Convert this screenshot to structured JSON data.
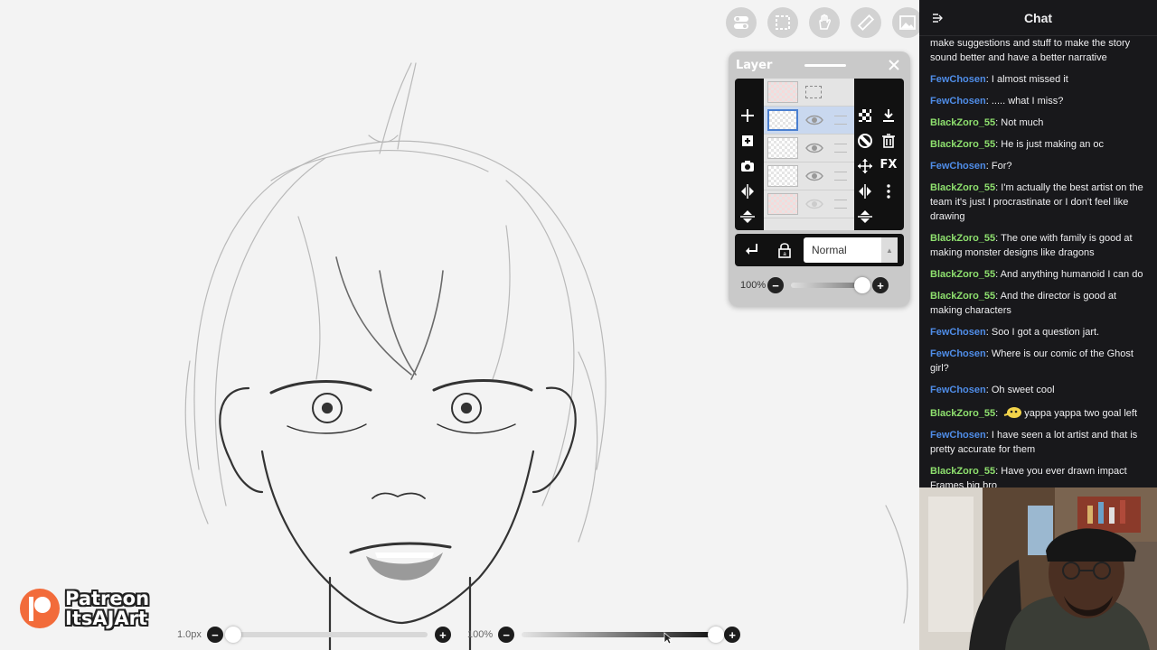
{
  "top_toolbar": {
    "tools": [
      {
        "icon": "toggle-icon"
      },
      {
        "icon": "selection-icon"
      },
      {
        "icon": "hand-icon"
      },
      {
        "icon": "ruler-icon"
      },
      {
        "icon": "image-icon"
      }
    ]
  },
  "layer_panel": {
    "title": "Layer",
    "blend_mode": "Normal",
    "opacity": "100%",
    "fx_label": "FX"
  },
  "bottom_bar": {
    "brush_size": "1.0px",
    "brush_opacity": "100%"
  },
  "watermark": {
    "line1": "Patreon",
    "line2": "ItsAJArt"
  },
  "chat": {
    "title": "Chat",
    "colors": {
      "FewChosen": "#4f8de8",
      "BlackZoro_55": "#8ee06e"
    },
    "messages": [
      {
        "user": "",
        "text": "make suggestions and stuff to make the story sound better and have a better narrative"
      },
      {
        "user": "FewChosen",
        "text": "I almost missed it"
      },
      {
        "user": "FewChosen",
        "text": "..... what I miss?"
      },
      {
        "user": "BlackZoro_55",
        "text": "Not much"
      },
      {
        "user": "BlackZoro_55",
        "text": "He is just making an oc"
      },
      {
        "user": "FewChosen",
        "text": "For?"
      },
      {
        "user": "BlackZoro_55",
        "text": "I'm actually the best artist on the team it's just I procrastinate or I don't feel like drawing"
      },
      {
        "user": "BlackZoro_55",
        "text": "The one with family is good at making monster designs like dragons"
      },
      {
        "user": "BlackZoro_55",
        "text": "And anything humanoid I can do"
      },
      {
        "user": "BlackZoro_55",
        "text": "And the director is good at making characters"
      },
      {
        "user": "FewChosen",
        "text": "Soo I got a question jart."
      },
      {
        "user": "FewChosen",
        "text": "Where is our comic of the Ghost girl?"
      },
      {
        "user": "FewChosen",
        "text": "Oh sweet cool"
      },
      {
        "user": "BlackZoro_55",
        "text": "yappa yappa two goal left",
        "emote": true
      },
      {
        "user": "FewChosen",
        "text": "I have seen a lot artist and that is pretty accurate for them"
      },
      {
        "user": "BlackZoro_55",
        "text": "Have you ever drawn impact Frames big bro"
      }
    ]
  }
}
